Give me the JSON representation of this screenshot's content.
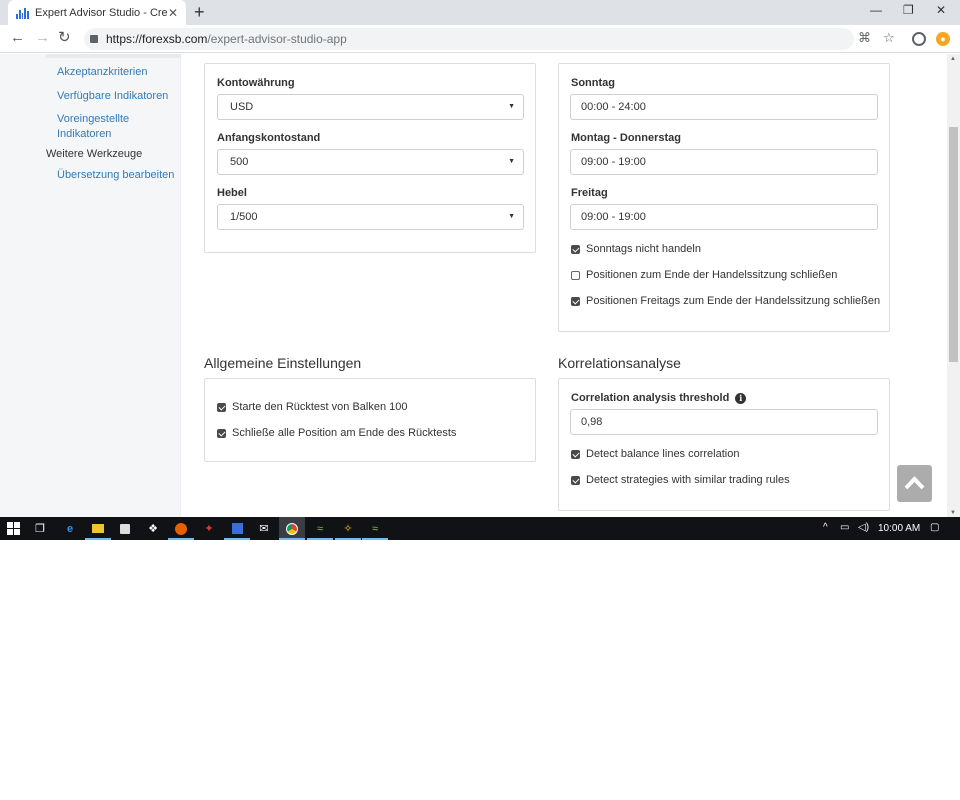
{
  "browser": {
    "tab_title": "Expert Advisor Studio - Create an",
    "tab_close": "✕",
    "new_tab": "+",
    "minimize": "—",
    "restore": "❐",
    "close": "✕",
    "url_host": "https://forexsb.com",
    "url_path": "/expert-advisor-studio-app"
  },
  "sidebar": {
    "links": [
      {
        "label": "Akzeptanzkriterien"
      },
      {
        "label": "Verfügbare Indikatoren"
      },
      {
        "label": "Voreingestellte Indikatoren"
      },
      {
        "label": "Übersetzung bearbeiten"
      }
    ],
    "heading_tools": "Weitere Werkzeuge"
  },
  "account": {
    "currency_label": "Kontowährung",
    "currency_value": "USD",
    "balance_label": "Anfangskontostand",
    "balance_value": "500",
    "leverage_label": "Hebel",
    "leverage_value": "1/500"
  },
  "trading_sessions": {
    "sunday_label": "Sonntag",
    "sunday_value": "00:00 - 24:00",
    "mon_thu_label": "Montag - Donnerstag",
    "mon_thu_value": "09:00 - 19:00",
    "friday_label": "Freitag",
    "friday_value": "09:00 - 19:00",
    "options": [
      {
        "label": "Sonntags nicht handeln",
        "checked": true
      },
      {
        "label": "Positionen zum Ende der Handelssitzung schließen",
        "checked": false
      },
      {
        "label": "Positionen Freitags zum Ende der Handelssitzung schließen",
        "checked": true
      }
    ]
  },
  "general": {
    "title": "Allgemeine Einstellungen",
    "options": [
      {
        "label": "Starte den Rücktest von Balken 100",
        "checked": true
      },
      {
        "label": "Schließe alle Position am Ende des Rücktests",
        "checked": true
      }
    ]
  },
  "correlation": {
    "title": "Korrelationsanalyse",
    "threshold_label": "Correlation analysis threshold",
    "threshold_value": "0,98",
    "options": [
      {
        "label": "Detect balance lines correlation",
        "checked": true
      },
      {
        "label": "Detect strategies with similar trading rules",
        "checked": true
      }
    ]
  },
  "taskbar": {
    "clock": "10:00 AM"
  }
}
